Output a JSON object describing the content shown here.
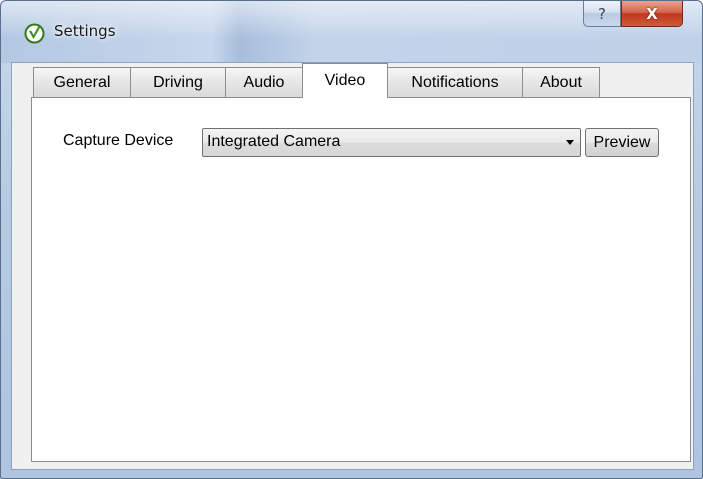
{
  "window": {
    "title": "Settings",
    "help_glyph": "?",
    "close_glyph": "X"
  },
  "tabs": [
    {
      "label": "General",
      "active": false
    },
    {
      "label": "Driving",
      "active": false
    },
    {
      "label": "Audio",
      "active": false
    },
    {
      "label": "Video",
      "active": true
    },
    {
      "label": "Notifications",
      "active": false
    },
    {
      "label": "About",
      "active": false
    }
  ],
  "video": {
    "capture_device_label": "Capture Device",
    "capture_device_value": "Integrated Camera",
    "preview_label": "Preview"
  },
  "icons": {
    "app": "green-checkmark-v-icon",
    "dropdown": "chevron-down-icon"
  },
  "colors": {
    "app_icon_green": "#3c8f1e",
    "close_red": "#c0391e"
  }
}
